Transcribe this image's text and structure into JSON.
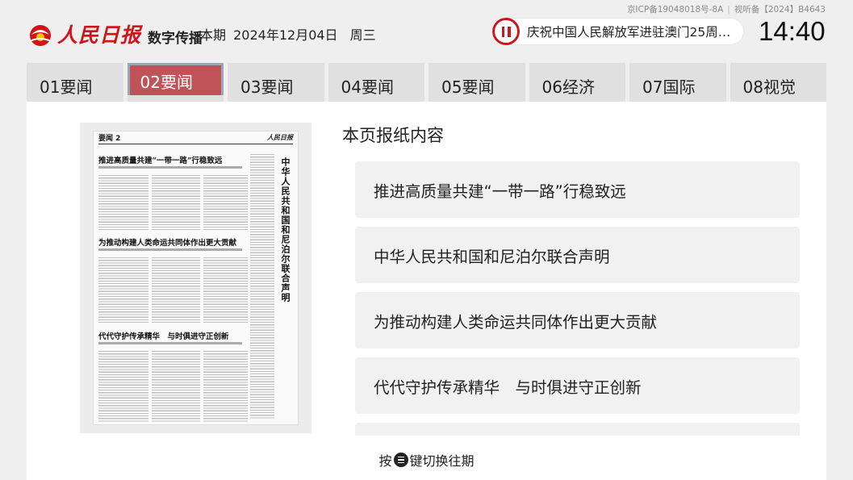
{
  "license": {
    "icp": "京ICP备19048018号-8A",
    "video": "视听备【2024】B4643"
  },
  "header": {
    "brand": "人民日报",
    "brand_suffix": "数字传播",
    "issue_label": "本期",
    "issue_date": "2024年12月04日",
    "weekday": "周三",
    "ticker": "庆祝中国人民解放军进驻澳门25周年...",
    "clock": "14:40"
  },
  "tabs": [
    {
      "label": "01要闻"
    },
    {
      "label": "02要闻"
    },
    {
      "label": "03要闻"
    },
    {
      "label": "04要闻"
    },
    {
      "label": "05要闻"
    },
    {
      "label": "06经济"
    },
    {
      "label": "07国际"
    },
    {
      "label": "08视觉"
    }
  ],
  "active_tab": 1,
  "thumbnail": {
    "section": "要闻  2",
    "brand": "人民日报",
    "headlines": [
      "推进高质量共建“一带一路”行稳致远",
      "为推动构建人类命运共同体作出更大贡献",
      "代代守护传承精华　与时俱进守正创新"
    ],
    "vertical_headline": "中华人民共和国和尼泊尔联合声明"
  },
  "content": {
    "title": "本页报纸内容",
    "articles": [
      "推进高质量共建“一带一路”行稳致远",
      "中华人民共和国和尼泊尔联合声明",
      "为推动构建人类命运共同体作出更大贡献",
      "代代守护传承精华　与时俱进守正创新",
      ""
    ]
  },
  "footer": {
    "prefix": "按",
    "key_icon": "menu-key-icon",
    "suffix": "键切换往期"
  },
  "colors": {
    "brand_red": "#d0141a",
    "active_tab": "#c0535a",
    "tab_bg": "#e0e0e0",
    "card_bg": "#f1f1f1"
  }
}
